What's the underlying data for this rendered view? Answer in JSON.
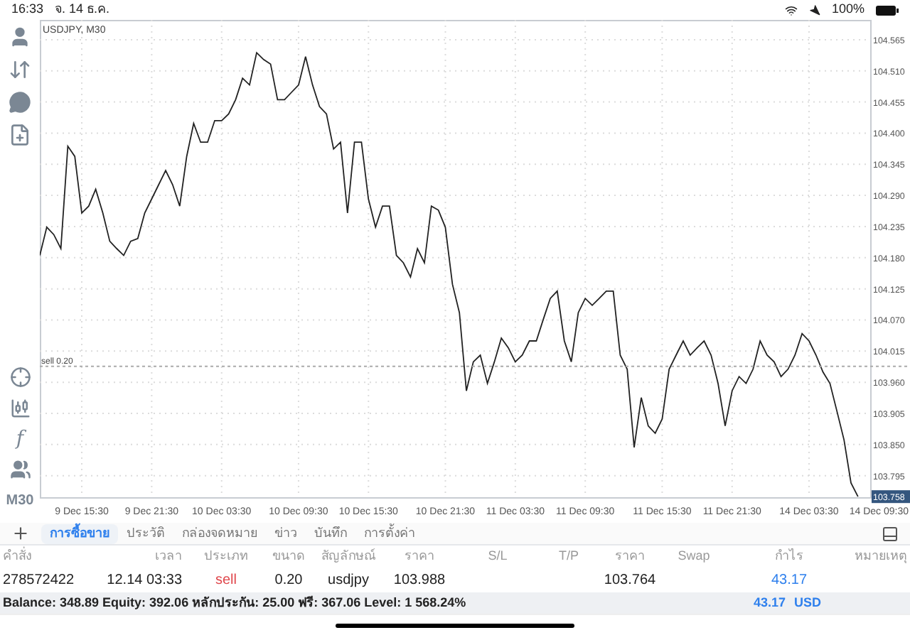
{
  "status_bar": {
    "time": "16:33",
    "date": "จ. 14 ธ.ค.",
    "battery": "100%"
  },
  "toolbar": {
    "function_glyph": "f",
    "timeframe": "M30"
  },
  "chart": {
    "chart_data": {
      "type": "line",
      "title": "USDJPY, M30",
      "grid": true,
      "categories": [
        null,
        null,
        null,
        null,
        null,
        null,
        "9 Dec 15:30",
        null,
        null,
        null,
        null,
        null,
        null,
        null,
        null,
        null,
        "9 Dec 21:30",
        null,
        null,
        null,
        null,
        null,
        null,
        null,
        null,
        null,
        "10 Dec 03:30",
        null,
        null,
        null,
        null,
        null,
        null,
        null,
        null,
        null,
        null,
        "10 Dec 09:30",
        null,
        null,
        null,
        null,
        null,
        null,
        null,
        null,
        null,
        "10 Dec 15:30",
        null,
        null,
        null,
        null,
        null,
        null,
        null,
        null,
        null,
        null,
        "10 Dec 21:30",
        null,
        null,
        null,
        null,
        null,
        null,
        null,
        null,
        null,
        "11 Dec 03:30",
        null,
        null,
        null,
        null,
        null,
        null,
        null,
        null,
        null,
        "11 Dec 09:30",
        null,
        null,
        null,
        null,
        null,
        null,
        null,
        null,
        null,
        null,
        "11 Dec 15:30",
        null,
        null,
        null,
        null,
        null,
        null,
        null,
        null,
        null,
        "11 Dec 21:30",
        null,
        null,
        null,
        null,
        null,
        null,
        null,
        null,
        null,
        null,
        "14 Dec 03:30",
        null,
        null,
        null,
        null,
        null,
        null,
        null,
        null,
        null,
        "14 Dec 09:30",
        null
      ],
      "series": [
        {
          "color": "#222222",
          "values": [
            104.184,
            104.234,
            104.221,
            104.196,
            104.377,
            104.359,
            104.259,
            104.271,
            104.301,
            104.259,
            104.209,
            104.196,
            104.184,
            104.209,
            104.214,
            104.259,
            104.284,
            104.309,
            104.334,
            104.309,
            104.271,
            104.359,
            104.417,
            104.384,
            104.384,
            104.422,
            104.422,
            104.434,
            104.459,
            104.497,
            104.485,
            104.542,
            104.53,
            104.522,
            104.459,
            104.459,
            104.472,
            104.485,
            104.535,
            104.485,
            104.447,
            104.434,
            104.372,
            104.384,
            104.259,
            104.384,
            104.384,
            104.284,
            104.234,
            104.271,
            104.271,
            104.184,
            104.171,
            104.146,
            104.196,
            104.171,
            104.271,
            104.264,
            104.234,
            104.133,
            104.083,
            103.945,
            103.996,
            104.008,
            103.958,
            103.996,
            104.038,
            104.021,
            103.996,
            104.008,
            104.033,
            104.033,
            104.071,
            104.108,
            104.121,
            104.033,
            103.996,
            104.083,
            104.108,
            104.096,
            104.108,
            104.121,
            104.121,
            104.008,
            103.983,
            103.845,
            103.933,
            103.883,
            103.87,
            103.895,
            103.983,
            104.008,
            104.033,
            104.008,
            104.021,
            104.033,
            104.008,
            103.958,
            103.883,
            103.945,
            103.97,
            103.958,
            103.983,
            104.033,
            104.008,
            103.996,
            103.97,
            103.983,
            104.008,
            104.046,
            104.033,
            104.008,
            103.978,
            103.958,
            103.908,
            103.858,
            103.782,
            103.758,
            null,
            null,
            null,
            null
          ]
        }
      ],
      "ylim": [
        103.757,
        104.6
      ],
      "yticks": [
        {
          "value": 104.565,
          "label": "104.565"
        },
        {
          "value": 104.51,
          "label": "104.510"
        },
        {
          "value": 104.455,
          "label": "104.455"
        },
        {
          "value": 104.4,
          "label": "104.400"
        },
        {
          "value": 104.345,
          "label": "104.345"
        },
        {
          "value": 104.29,
          "label": "104.290"
        },
        {
          "value": 104.235,
          "label": "104.235"
        },
        {
          "value": 104.18,
          "label": "104.180"
        },
        {
          "value": 104.125,
          "label": "104.125"
        },
        {
          "value": 104.07,
          "label": "104.070"
        },
        {
          "value": 104.015,
          "label": "104.015"
        },
        {
          "value": 103.96,
          "label": "103.960"
        },
        {
          "value": 103.905,
          "label": "103.905"
        },
        {
          "value": 103.85,
          "label": "103.850"
        },
        {
          "value": 103.795,
          "label": "103.795"
        }
      ],
      "ref_lines": [
        {
          "axis": "y",
          "value": 103.988,
          "label": "sell 0.20"
        }
      ],
      "annotations": [
        {
          "text": "103.758",
          "y": 103.758
        }
      ]
    }
  },
  "tabs": [
    {
      "label": "การซื้อขาย",
      "selected": true
    },
    {
      "label": "ประวัติ",
      "selected": false
    },
    {
      "label": "กล่องจดหมาย",
      "selected": false
    },
    {
      "label": "ข่าว",
      "selected": false
    },
    {
      "label": "บันทึก",
      "selected": false
    },
    {
      "label": "การตั้งค่า",
      "selected": false
    }
  ],
  "table": {
    "columns": [
      "คำสั่ง",
      "เวลา",
      "ประเภท",
      "ขนาด",
      "สัญลักษณ์",
      "ราคา",
      "S/L",
      "T/P",
      "ราคา",
      "Swap",
      "กำไร",
      "หมายเหตุ"
    ],
    "rows": [
      {
        "order": "278572422",
        "time": "12.14 03:33",
        "type": "sell",
        "volume": "0.20",
        "symbol": "usdjpy",
        "open_price": "103.988",
        "current_price": "103.764",
        "profit": "43.17"
      }
    ]
  },
  "summary": {
    "text": "Balance: 348.89 Equity: 392.06 หลักประกัน: 25.00 ฟรี: 367.06 Level: 1 568.24%",
    "profit": "43.17",
    "currency": "USD"
  }
}
